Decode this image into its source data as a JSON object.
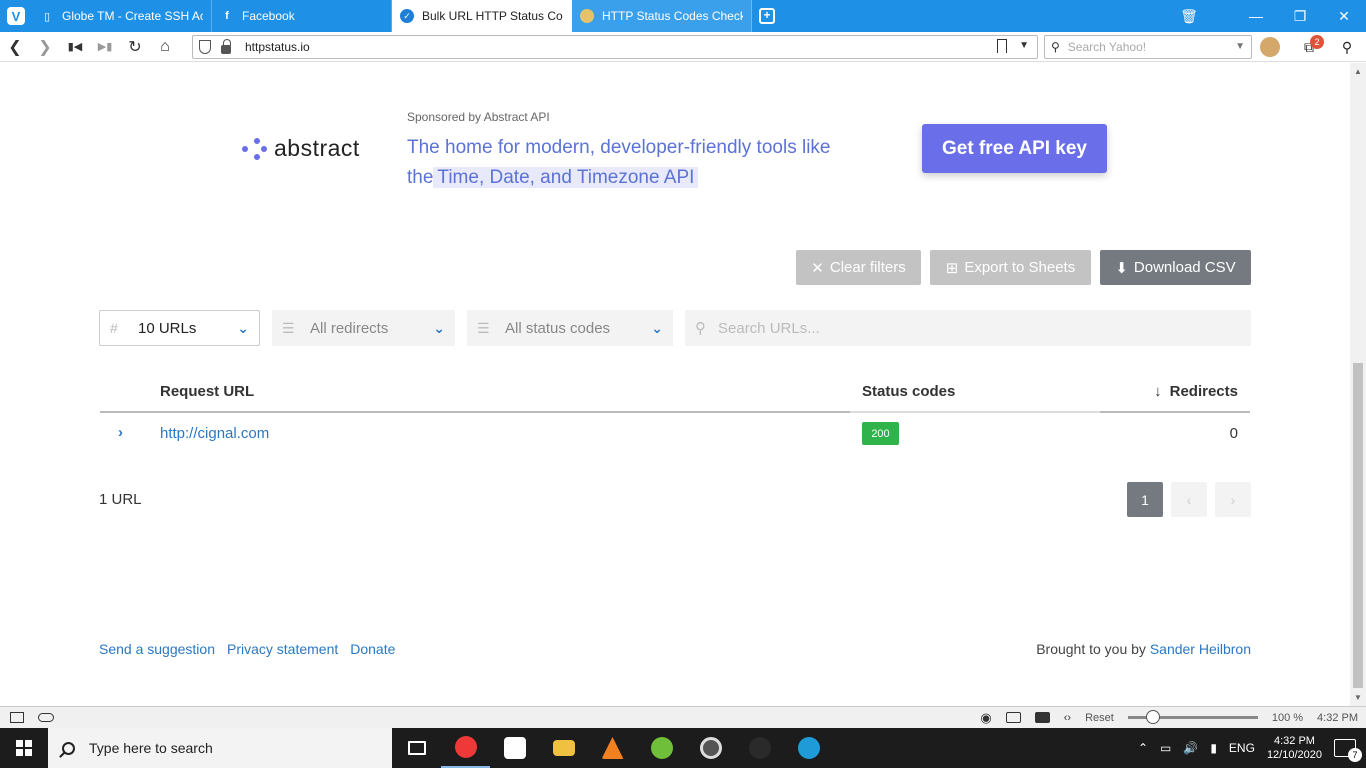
{
  "browser": {
    "tabs": [
      {
        "title": "Globe TM - Create SSH Acc",
        "icon": "document-icon"
      },
      {
        "title": "Facebook",
        "icon": "facebook-icon"
      },
      {
        "title": "Bulk URL HTTP Status Code",
        "icon": "httpstatus-icon"
      },
      {
        "title": "HTTP Status Codes Checker",
        "icon": "globe-icon"
      }
    ],
    "url": "httpstatus.io",
    "search_placeholder": "Search Yahoo!",
    "extension_badge": "2"
  },
  "ad": {
    "sponsor": "Sponsored by Abstract API",
    "brand": "abstract",
    "text_line1": "The home for modern, developer-friendly tools like",
    "text_the": "the",
    "text_highlight": "Time, Date, and Timezone API",
    "cta": "Get free API key",
    "brand_color": "#6a6ee8"
  },
  "actions": {
    "clear_filters": "Clear filters",
    "export_sheets": "Export to Sheets",
    "download_csv": "Download CSV"
  },
  "filters": {
    "urls": "10 URLs",
    "redirects": "All redirects",
    "status_codes": "All status codes",
    "search_placeholder": "Search URLs..."
  },
  "table": {
    "headers": {
      "url": "Request URL",
      "status": "Status codes",
      "redirects": "Redirects"
    },
    "rows": [
      {
        "url": "http://cignal.com",
        "status": "200",
        "redirects": "0"
      }
    ],
    "status_color": "#2fb34a",
    "link_color": "#2b78c2"
  },
  "results": {
    "count": "1 URL",
    "page": "1",
    "prev": "‹",
    "next": "›"
  },
  "footer": {
    "suggestion": "Send a suggestion",
    "privacy": "Privacy statement",
    "donate": "Donate",
    "credit_prefix": "Brought to you by",
    "credit_name": "Sander Heilbron"
  },
  "statusbar": {
    "reset": "Reset",
    "zoom": "100 %",
    "time": "4:32 PM"
  },
  "taskbar": {
    "search_placeholder": "Type here to search",
    "language": "ENG",
    "time": "4:32 PM",
    "date": "12/10/2020",
    "notifications": "7"
  }
}
